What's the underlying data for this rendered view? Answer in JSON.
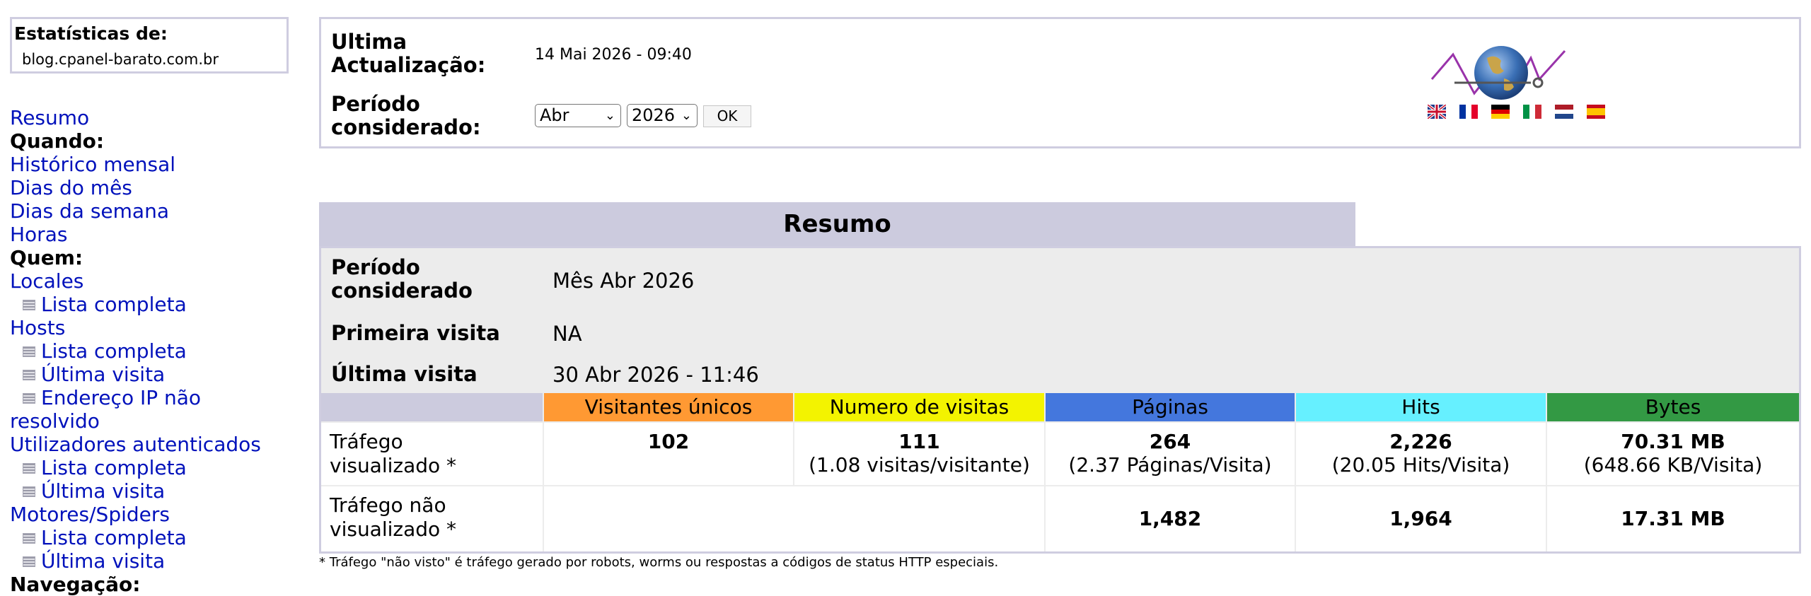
{
  "sidebar": {
    "stats_label": "Estatísticas de:",
    "site": "blog.cpanel-barato.com.br",
    "nav": [
      {
        "type": "link",
        "label": "Resumo"
      },
      {
        "type": "section",
        "label": "Quando:"
      },
      {
        "type": "link",
        "label": "Histórico mensal"
      },
      {
        "type": "link",
        "label": "Dias do mês"
      },
      {
        "type": "link",
        "label": "Dias da semana"
      },
      {
        "type": "link",
        "label": "Horas"
      },
      {
        "type": "section",
        "label": "Quem:"
      },
      {
        "type": "link",
        "label": "Locales"
      },
      {
        "type": "sublink",
        "label": "Lista completa",
        "icon": "list-icon"
      },
      {
        "type": "link",
        "label": "Hosts"
      },
      {
        "type": "sublink",
        "label": "Lista completa",
        "icon": "list-icon"
      },
      {
        "type": "sublink",
        "label": "Última visita",
        "icon": "list-icon"
      },
      {
        "type": "sublink",
        "label": "Endereço IP não",
        "icon": "list-icon"
      },
      {
        "type": "link",
        "label": "resolvido"
      },
      {
        "type": "link",
        "label": "Utilizadores autenticados"
      },
      {
        "type": "sublink",
        "label": "Lista completa",
        "icon": "list-icon"
      },
      {
        "type": "sublink",
        "label": "Última visita",
        "icon": "list-icon"
      },
      {
        "type": "link",
        "label": "Motores/Spiders"
      },
      {
        "type": "sublink",
        "label": "Lista completa",
        "icon": "list-icon"
      },
      {
        "type": "sublink",
        "label": "Última visita",
        "icon": "list-icon"
      },
      {
        "type": "section",
        "label": "Navegação:"
      }
    ]
  },
  "top": {
    "update_label_1": "Ultima",
    "update_label_2": "Actualização:",
    "update_value": "14 Mai 2026 - 09:40",
    "period_label_1": "Período",
    "period_label_2": "considerado:",
    "month_selected": "Abr",
    "year_selected": "2026",
    "ok_label": "OK",
    "flags": [
      "uk-flag-icon",
      "fr-flag-icon",
      "de-flag-icon",
      "it-flag-icon",
      "nl-flag-icon",
      "es-flag-icon"
    ]
  },
  "summary": {
    "title": "Resumo",
    "period_label_1": "Período",
    "period_label_2": "considerado",
    "period_value": "Mês Abr 2026",
    "first_visit_label": "Primeira visita",
    "first_visit_value": "NA",
    "last_visit_label": "Última visita",
    "last_visit_value": "30 Abr 2026 - 11:46",
    "columns": [
      {
        "label": "Visitantes únicos",
        "color": "#ff9933"
      },
      {
        "label": "Numero de visitas",
        "color": "#f3f300"
      },
      {
        "label": "Páginas",
        "color": "#4477dd"
      },
      {
        "label": "Hits",
        "color": "#66f0ff"
      },
      {
        "label": "Bytes",
        "color": "#339944"
      }
    ],
    "viewed": {
      "label_1": "Tráfego",
      "label_2": "visualizado *",
      "unique": "102",
      "visits": "111",
      "visits_sub": "(1.08 visitas/visitante)",
      "pages": "264",
      "pages_sub": "(2.37 Páginas/Visita)",
      "hits": "2,226",
      "hits_sub": "(20.05 Hits/Visita)",
      "bytes": "70.31 MB",
      "bytes_sub": "(648.66 KB/Visita)"
    },
    "not_viewed": {
      "label_1": "Tráfego não",
      "label_2": "visualizado *",
      "pages": "1,482",
      "hits": "1,964",
      "bytes": "17.31 MB"
    }
  },
  "footnote": "* Tráfego \"não visto\" é tráfego gerado por robots, worms ou respostas a códigos de status HTTP especiais."
}
